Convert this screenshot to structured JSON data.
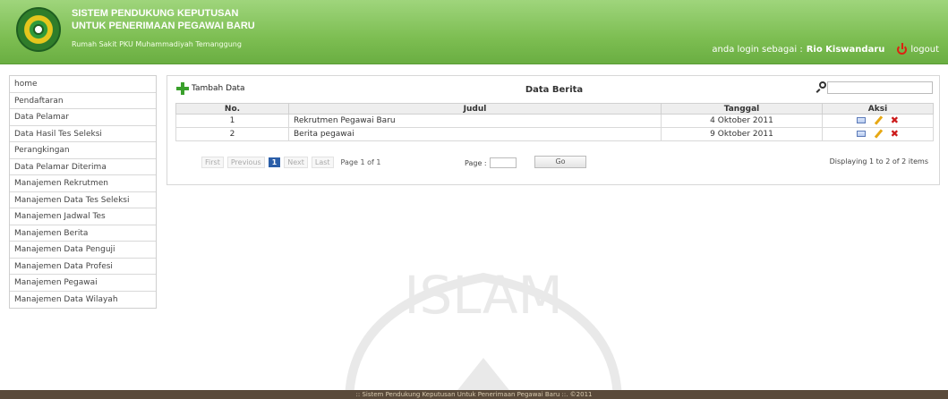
{
  "header": {
    "title_line1": "SISTEM PENDUKUNG KEPUTUSAN",
    "title_line2": "UNTUK PENERIMAAN PEGAWAI BARU",
    "subtitle": "Rumah Sakit PKU Muhammadiyah Temanggung",
    "login_prefix": "anda login sebagai :",
    "login_user": "Rio Kiswandaru",
    "logout_label": "logout"
  },
  "sidebar": {
    "items": [
      {
        "label": "home"
      },
      {
        "label": "Pendaftaran"
      },
      {
        "label": "Data Pelamar"
      },
      {
        "label": "Data Hasil Tes Seleksi"
      },
      {
        "label": "Perangkingan"
      },
      {
        "label": "Data Pelamar Diterima"
      },
      {
        "label": "Manajemen Rekrutmen"
      },
      {
        "label": "Manajemen Data Tes Seleksi"
      },
      {
        "label": "Manajemen Jadwal Tes"
      },
      {
        "label": "Manajemen Berita"
      },
      {
        "label": "Manajemen Data Penguji"
      },
      {
        "label": "Manajemen Data Profesi"
      },
      {
        "label": "Manajemen Pegawai"
      },
      {
        "label": "Manajemen Data Wilayah"
      }
    ]
  },
  "main": {
    "add_label": "Tambah Data",
    "title": "Data Berita",
    "table": {
      "headers": [
        "No.",
        "Judul",
        "Tanggal",
        "Aksi"
      ],
      "rows": [
        {
          "no": "1",
          "judul": "Rekrutmen Pegawai Baru",
          "tanggal": "4 Oktober 2011"
        },
        {
          "no": "2",
          "judul": "Berita pegawai",
          "tanggal": "9 Oktober 2011"
        }
      ]
    },
    "pager": {
      "first": "First",
      "previous": "Previous",
      "current": "1",
      "next": "Next",
      "last": "Last",
      "page_of": "Page 1 of 1",
      "page_label": "Page :",
      "go": "Go",
      "display": "Displaying 1 to 2 of 2 items"
    }
  },
  "watermark": {
    "text": "ISLAM"
  },
  "footer": {
    "text": ":: Sistem Pendukung Keputusan Untuk Penerimaan Pegawai Baru ::. ©2011"
  },
  "icons": {
    "logo": "logo-icon",
    "logout": "power-icon",
    "add": "plus-icon",
    "search": "search-icon",
    "view": "view-icon",
    "edit": "edit-icon",
    "delete": "delete-icon"
  }
}
